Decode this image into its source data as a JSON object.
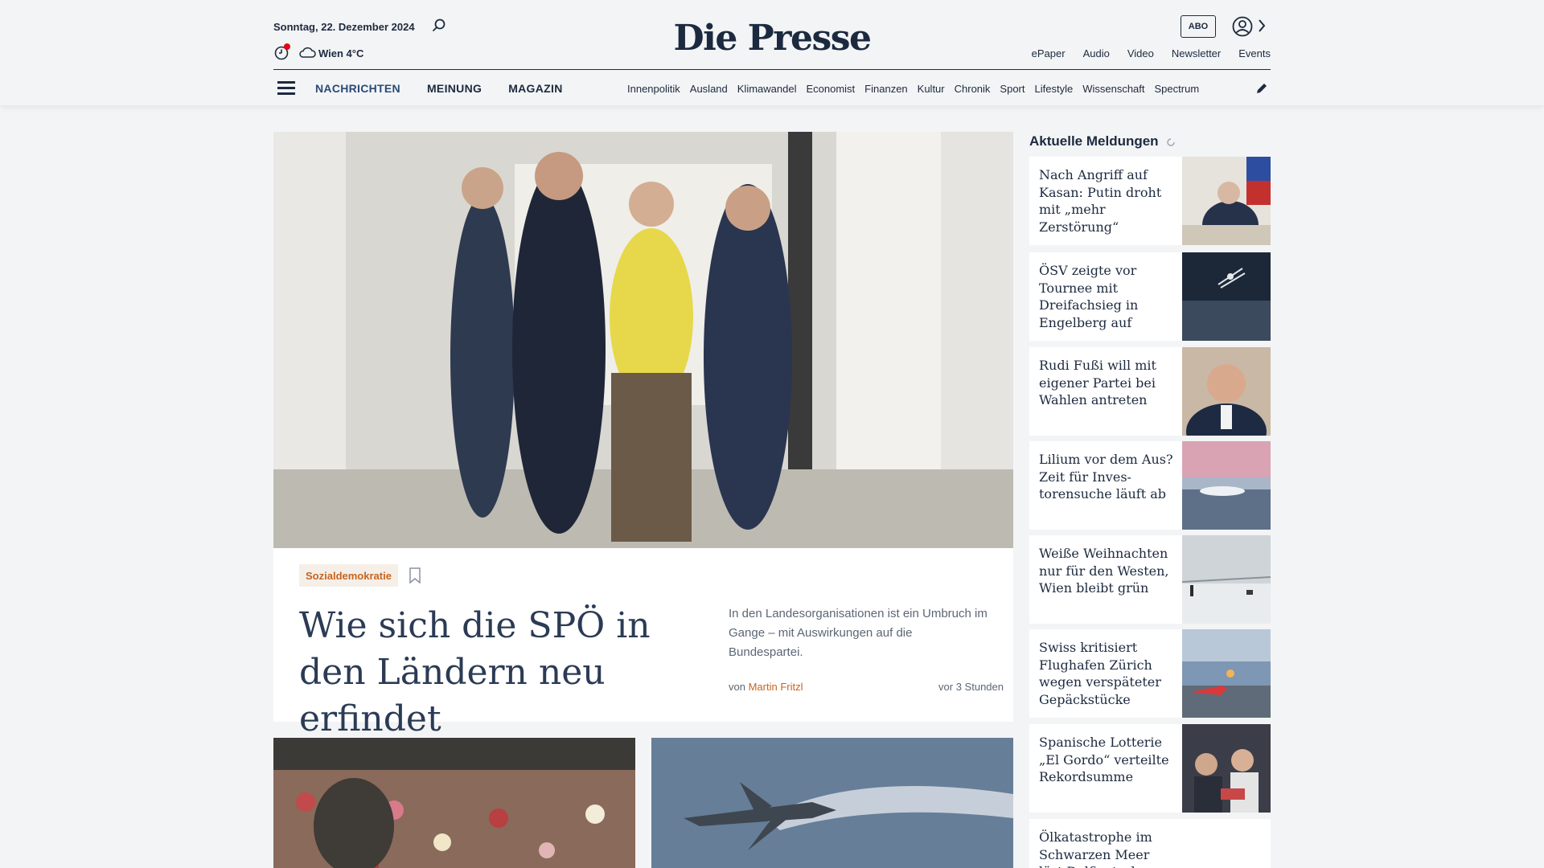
{
  "header": {
    "date": "Sonntag, 22. Dezember 2024",
    "weather": "Wien 4°C",
    "logo": "Die Presse",
    "abo": "ABO",
    "top_links": [
      "ePaper",
      "Audio",
      "Video",
      "Newsletter",
      "Events"
    ],
    "main_nav": [
      "NACHRICHTEN",
      "MEINUNG",
      "MAGAZIN"
    ],
    "sub_nav": [
      "Innenpolitik",
      "Ausland",
      "Klimawandel",
      "Economist",
      "Finanzen",
      "Kultur",
      "Chronik",
      "Sport",
      "Lifestyle",
      "Wissenschaft",
      "Spectrum"
    ]
  },
  "hero": {
    "kicker": "Sozialdemokratie",
    "headline": "Wie sich die SPÖ in den Ländern neu erfindet",
    "teaser": "In den Landesorganisationen ist ein Umbruch im Gange – mit Auswirkungen auf die Bundespartei.",
    "byline_prefix": "von",
    "author": "Martin Fritzl",
    "time": "vor 3 Stunden"
  },
  "sidebar": {
    "title": "Aktuelle Meldungen",
    "items": [
      {
        "title": "Nach Angriff auf Kasan: Putin droht mit „mehr Zerstörung“"
      },
      {
        "title": "ÖSV zeigte vor Tournee mit Dreifachsieg in Engelberg auf"
      },
      {
        "title": "Rudi Fußi will mit eigener Partei bei Wahlen antreten"
      },
      {
        "title": "Lilium vor dem Aus? Zeit für Inves­torensuche läuft ab"
      },
      {
        "title": "Weiße Weihnachten nur für den Westen, Wien bleibt grün"
      },
      {
        "title": "Swiss kritisiert Flughafen Zürich wegen verspäteter Gepäckstücke"
      },
      {
        "title": "Spanische Lotterie „El Gordo“ verteilte Rekordsumme"
      },
      {
        "title": "Ölkatastrophe im Schwarzen Meer löst Delfinsterben aus"
      }
    ]
  },
  "colors": {
    "navy": "#1c2a3f",
    "accent_orange": "#c8641e",
    "live_red": "#e30613"
  }
}
